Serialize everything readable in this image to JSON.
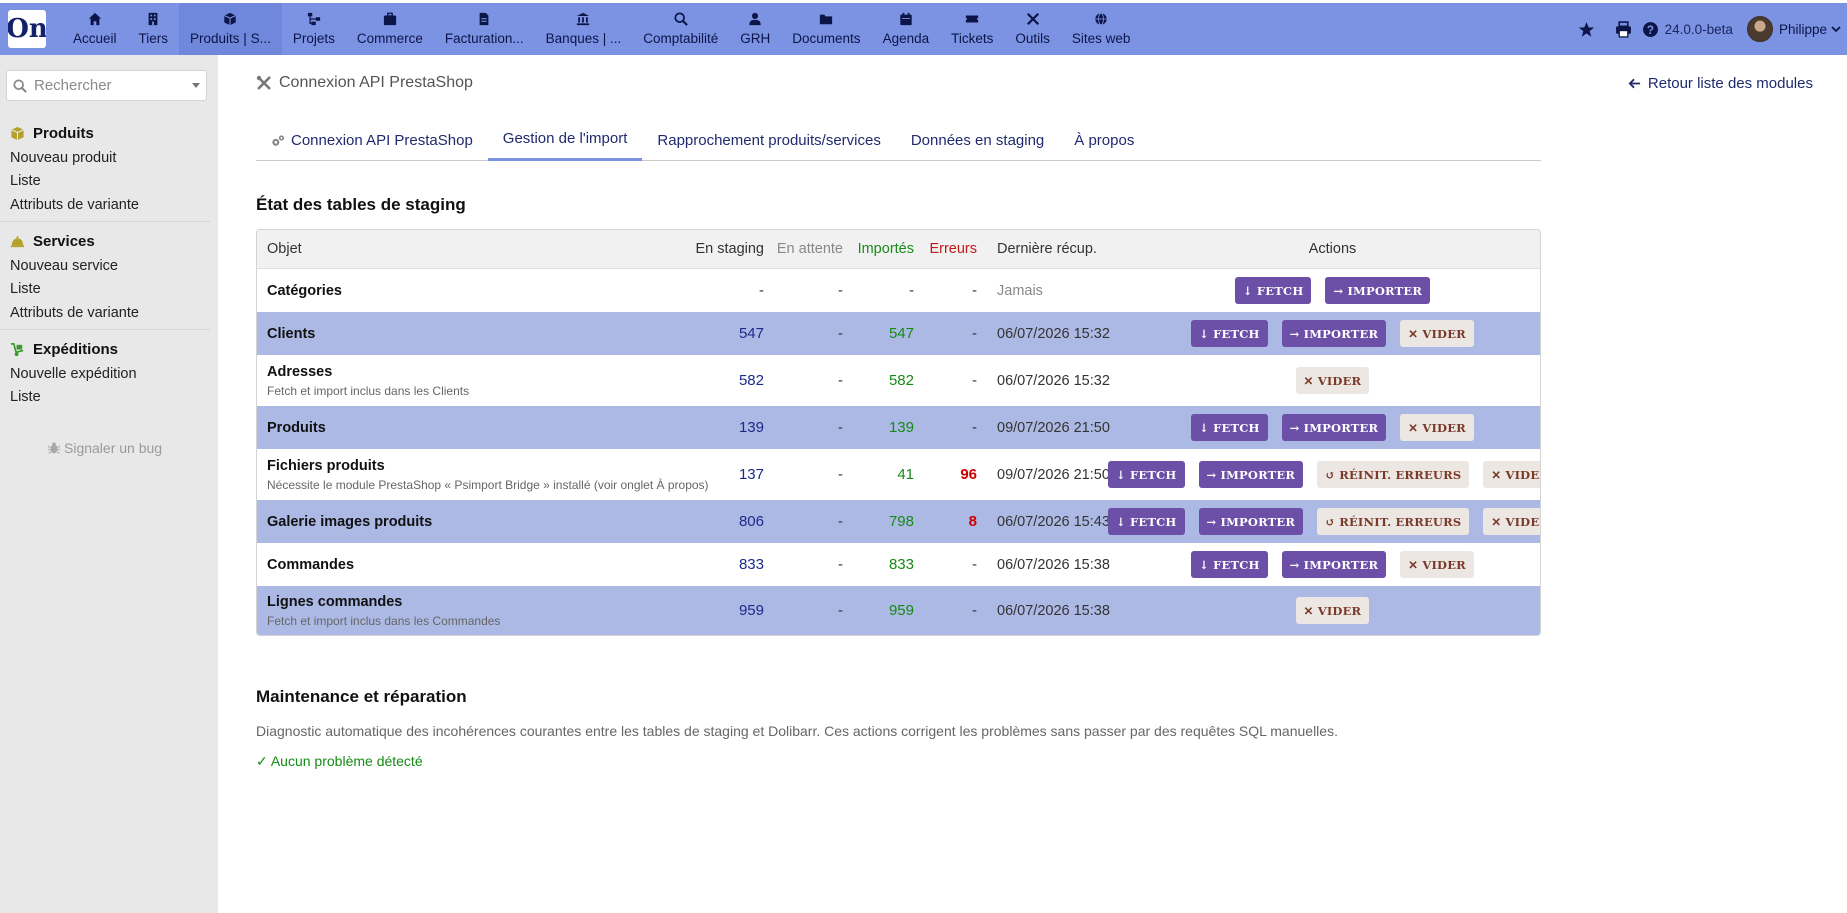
{
  "topbar": {
    "menu": [
      {
        "label": "Accueil",
        "icon": "home-icon"
      },
      {
        "label": "Tiers",
        "icon": "building-icon"
      },
      {
        "label": "Produits | S...",
        "icon": "box-icon"
      },
      {
        "label": "Projets",
        "icon": "sitemap-icon"
      },
      {
        "label": "Commerce",
        "icon": "briefcase-icon"
      },
      {
        "label": "Facturation...",
        "icon": "invoice-icon"
      },
      {
        "label": "Banques | ...",
        "icon": "bank-icon"
      },
      {
        "label": "Comptabilité",
        "icon": "search-dollar-icon"
      },
      {
        "label": "GRH",
        "icon": "user-tie-icon"
      },
      {
        "label": "Documents",
        "icon": "folder-icon"
      },
      {
        "label": "Agenda",
        "icon": "calendar-icon"
      },
      {
        "label": "Tickets",
        "icon": "ticket-icon"
      },
      {
        "label": "Outils",
        "icon": "tools-icon"
      },
      {
        "label": "Sites web",
        "icon": "globe-icon"
      }
    ],
    "version": "24.0.0-beta",
    "user": "Philippe"
  },
  "sidebar": {
    "search_placeholder": "Rechercher",
    "sections": [
      {
        "title": "Produits",
        "icon": "cube-icon",
        "links": [
          "Nouveau produit",
          "Liste",
          "Attributs de variante"
        ]
      },
      {
        "title": "Services",
        "icon": "concierge-bell-icon",
        "links": [
          "Nouveau service",
          "Liste",
          "Attributs de variante"
        ]
      },
      {
        "title": "Expéditions",
        "icon": "dolly-icon",
        "links": [
          "Nouvelle expédition",
          "Liste"
        ]
      }
    ],
    "bug_link": "Signaler un bug"
  },
  "header": {
    "title": "Connexion API PrestaShop",
    "back_link": "Retour liste des modules"
  },
  "tabs": [
    {
      "label": "Connexion API PrestaShop"
    },
    {
      "label": "Gestion de l'import"
    },
    {
      "label": "Rapprochement produits/services"
    },
    {
      "label": "Données en staging"
    },
    {
      "label": "À propos"
    }
  ],
  "staging": {
    "title": "État des tables de staging",
    "columns": {
      "objet": "Objet",
      "staging": "En staging",
      "attente": "En attente",
      "importes": "Importés",
      "erreurs": "Erreurs",
      "recup": "Dernière récup.",
      "actions": "Actions"
    },
    "rows": [
      {
        "name": "Catégories",
        "sub": "",
        "staging": "-",
        "attente": "-",
        "importes": "-",
        "erreurs": "-",
        "date": "Jamais",
        "actions": [
          "fetch",
          "import"
        ]
      },
      {
        "name": "Clients",
        "sub": "",
        "staging": "547",
        "attente": "-",
        "importes": "547",
        "erreurs": "-",
        "date": "06/07/2026 15:32",
        "actions": [
          "fetch",
          "import",
          "vider"
        ]
      },
      {
        "name": "Adresses",
        "sub": "Fetch et import inclus dans les Clients",
        "staging": "582",
        "attente": "-",
        "importes": "582",
        "erreurs": "-",
        "date": "06/07/2026 15:32",
        "actions": [
          "vider"
        ]
      },
      {
        "name": "Produits",
        "sub": "",
        "staging": "139",
        "attente": "-",
        "importes": "139",
        "erreurs": "-",
        "date": "09/07/2026 21:50",
        "actions": [
          "fetch",
          "import",
          "vider"
        ]
      },
      {
        "name": "Fichiers produits",
        "sub": "Nécessite le module PrestaShop « Psimport Bridge » installé (voir onglet À propos)",
        "staging": "137",
        "attente": "-",
        "importes": "41",
        "erreurs": "96",
        "date": "09/07/2026 21:50",
        "actions": [
          "fetch",
          "import",
          "reinit",
          "vider"
        ]
      },
      {
        "name": "Galerie images produits",
        "sub": "",
        "staging": "806",
        "attente": "-",
        "importes": "798",
        "erreurs": "8",
        "date": "06/07/2026 15:43",
        "actions": [
          "fetch",
          "import",
          "reinit",
          "vider"
        ]
      },
      {
        "name": "Commandes",
        "sub": "",
        "staging": "833",
        "attente": "-",
        "importes": "833",
        "erreurs": "-",
        "date": "06/07/2026 15:38",
        "actions": [
          "fetch",
          "import",
          "vider"
        ]
      },
      {
        "name": "Lignes commandes",
        "sub": "Fetch et import inclus dans les Commandes",
        "staging": "959",
        "attente": "-",
        "importes": "959",
        "erreurs": "-",
        "date": "06/07/2026 15:38",
        "actions": [
          "vider"
        ]
      }
    ]
  },
  "buttons": {
    "fetch": "↓ FETCH",
    "import": "→ IMPORTER",
    "reinit": "↺ RÉINIT. ERREURS",
    "vider": "✕ VIDER"
  },
  "maintenance": {
    "title": "Maintenance et réparation",
    "description": "Diagnostic automatique des incohérences courantes entre les tables de staging et Dolibarr. Ces actions corrigent les problèmes sans passer par des requêtes SQL manuelles.",
    "status": "✓ Aucun problème détecté"
  },
  "colors": {
    "topbar": "#7b93e2",
    "alt_row": "#acb9e5",
    "primary_button": "#6c4fa6",
    "success": "#158a15",
    "error": "#cc0000"
  }
}
